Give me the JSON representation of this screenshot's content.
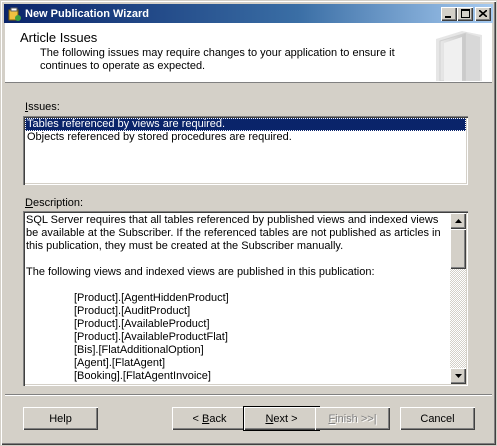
{
  "window": {
    "title": "New Publication Wizard",
    "controls": {
      "minimize": "_",
      "maximize": "□",
      "close": "✕"
    }
  },
  "header": {
    "title": "Article Issues",
    "subtitle": "The following issues may require changes to your application to ensure it continues to operate as expected."
  },
  "issues": {
    "label_prefix": "",
    "label_hotkey": "I",
    "label_rest": "ssues:",
    "items": [
      {
        "label": "Tables referenced by views are required.",
        "selected": true
      },
      {
        "label": "Objects referenced by stored procedures are required.",
        "selected": false
      }
    ]
  },
  "description": {
    "label_prefix": "",
    "label_hotkey": "D",
    "label_rest": "escription:",
    "paragraph1": "SQL Server requires that all tables referenced by published views and indexed views be available at the Subscriber. If the referenced tables are not published as articles in this publication, they must be created at the Subscriber manually.",
    "paragraph2": "The following views and indexed views are published in this publication:",
    "objects": [
      "[Product].[AgentHiddenProduct]",
      "[Product].[AuditProduct]",
      "[Product].[AvailableProduct]",
      "[Product].[AvailableProductFlat]",
      "[Bis].[FlatAdditionalOption]",
      "[Agent].[FlatAgent]",
      "[Booking].[FlatAgentInvoice]"
    ]
  },
  "buttons": {
    "help": {
      "label": "Help",
      "hotkey": ""
    },
    "back": {
      "prefix": "< ",
      "hotkey": "B",
      "rest": "ack"
    },
    "next": {
      "prefix": "",
      "hotkey": "N",
      "rest": "ext >"
    },
    "finish": {
      "prefix": "",
      "hotkey": "F",
      "rest": "inish >>|"
    },
    "cancel": {
      "label": "Cancel"
    }
  },
  "icons": {
    "app_icon": "wizard-icon",
    "header_art": "book-pages-icon",
    "scroll_up": "scroll-up-arrow-icon",
    "scroll_down": "scroll-down-arrow-icon"
  }
}
